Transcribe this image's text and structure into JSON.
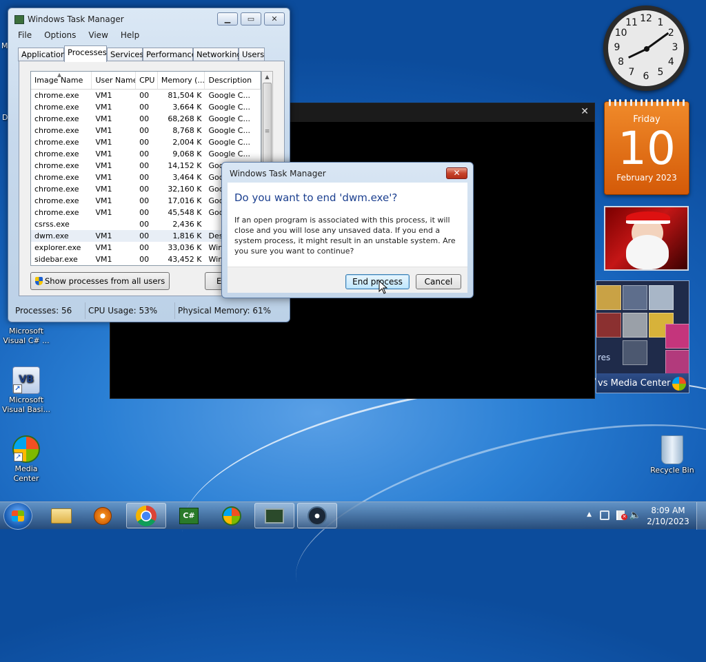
{
  "desktop": {
    "icons": [
      {
        "label": "Microsoft Visual C# ..."
      },
      {
        "label": "Microsoft Visual Basi..."
      },
      {
        "label": "Media Center"
      },
      {
        "label": "Recycle Bin"
      }
    ],
    "partial_labels": {
      "left_top": "M",
      "left_mid": "D"
    }
  },
  "gadgets": {
    "clock": {
      "numbers": [
        "12",
        "1",
        "2",
        "3",
        "4",
        "5",
        "6",
        "7",
        "8",
        "9",
        "10",
        "11"
      ],
      "hour": 8,
      "minute": 9
    },
    "calendar": {
      "weekday": "Friday",
      "day": "10",
      "month_year": "February 2023"
    },
    "media_center": {
      "label_fragment": "res",
      "footer": "vs Media Center"
    }
  },
  "task_manager": {
    "title": "Windows Task Manager",
    "menu": [
      "File",
      "Options",
      "View",
      "Help"
    ],
    "tabs": [
      "Applications",
      "Processes",
      "Services",
      "Performance",
      "Networking",
      "Users"
    ],
    "active_tab": "Processes",
    "columns": [
      "Image Name",
      "User Name",
      "CPU",
      "Memory (...",
      "Description"
    ],
    "rows": [
      {
        "name": "chrome.exe",
        "user": "VM1",
        "cpu": "00",
        "mem": "81,504 K",
        "desc": "Google C..."
      },
      {
        "name": "chrome.exe",
        "user": "VM1",
        "cpu": "00",
        "mem": "3,664 K",
        "desc": "Google C..."
      },
      {
        "name": "chrome.exe",
        "user": "VM1",
        "cpu": "00",
        "mem": "68,268 K",
        "desc": "Google C..."
      },
      {
        "name": "chrome.exe",
        "user": "VM1",
        "cpu": "00",
        "mem": "8,768 K",
        "desc": "Google C..."
      },
      {
        "name": "chrome.exe",
        "user": "VM1",
        "cpu": "00",
        "mem": "2,004 K",
        "desc": "Google C..."
      },
      {
        "name": "chrome.exe",
        "user": "VM1",
        "cpu": "00",
        "mem": "9,068 K",
        "desc": "Google C..."
      },
      {
        "name": "chrome.exe",
        "user": "VM1",
        "cpu": "00",
        "mem": "14,152 K",
        "desc": "Goo"
      },
      {
        "name": "chrome.exe",
        "user": "VM1",
        "cpu": "00",
        "mem": "3,464 K",
        "desc": "Goo"
      },
      {
        "name": "chrome.exe",
        "user": "VM1",
        "cpu": "00",
        "mem": "32,160 K",
        "desc": "Goo"
      },
      {
        "name": "chrome.exe",
        "user": "VM1",
        "cpu": "00",
        "mem": "17,016 K",
        "desc": "Goo"
      },
      {
        "name": "chrome.exe",
        "user": "VM1",
        "cpu": "00",
        "mem": "45,548 K",
        "desc": "Goo"
      },
      {
        "name": "csrss.exe",
        "user": "",
        "cpu": "00",
        "mem": "2,436 K",
        "desc": ""
      },
      {
        "name": "dwm.exe",
        "user": "VM1",
        "cpu": "00",
        "mem": "1,816 K",
        "desc": "Des"
      },
      {
        "name": "explorer.exe",
        "user": "VM1",
        "cpu": "00",
        "mem": "33,036 K",
        "desc": "Win"
      },
      {
        "name": "sidebar.exe",
        "user": "VM1",
        "cpu": "00",
        "mem": "43,452 K",
        "desc": "Win"
      }
    ],
    "show_all_label": "Show processes from all users",
    "end_button_fragment": "E",
    "status": {
      "processes": "Processes: 56",
      "cpu": "CPU Usage: 53%",
      "memory": "Physical Memory: 61%"
    }
  },
  "dialog": {
    "title": "Windows Task Manager",
    "close_glyph": "✕",
    "heading": "Do you want to end 'dwm.exe'?",
    "message": "If an open program is associated with this process, it will close and you will lose any unsaved data. If you end a system process, it might result in an unstable system. Are you sure you want to continue?",
    "end_label": "End process",
    "cancel_label": "Cancel"
  },
  "console_window": {
    "close_glyph": "✕"
  },
  "taskbar": {
    "items": [
      "start-orb",
      "explorer",
      "media-player",
      "chrome",
      "csharp",
      "media-center",
      "task-manager",
      "steam"
    ],
    "tray": {
      "time": "8:09 AM",
      "date": "2/10/2023",
      "chevron": "▲"
    }
  }
}
